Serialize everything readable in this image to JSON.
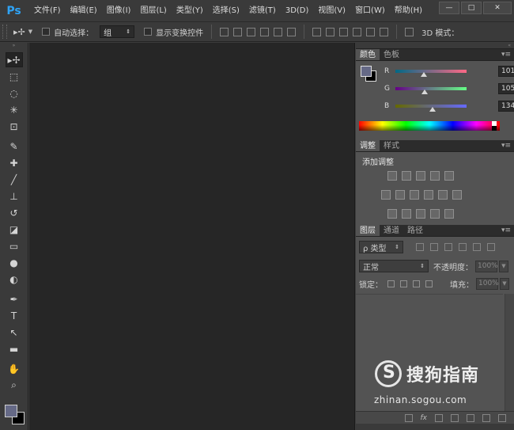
{
  "app": {
    "logo": "Ps"
  },
  "menu": [
    "文件(F)",
    "编辑(E)",
    "图像(I)",
    "图层(L)",
    "类型(Y)",
    "选择(S)",
    "滤镜(T)",
    "3D(D)",
    "视图(V)",
    "窗口(W)",
    "帮助(H)"
  ],
  "window_controls": {
    "minimize": "—",
    "maximize": "□",
    "close": "✕"
  },
  "options_bar": {
    "auto_select_label": "自动选择：",
    "auto_select_value": "组",
    "show_transform_label": "显示变换控件",
    "mode_3d_label": "3D 模式："
  },
  "tools": [
    {
      "name": "move-tool",
      "glyph": "▸✢"
    },
    {
      "name": "marquee-tool",
      "glyph": "⬚"
    },
    {
      "name": "lasso-tool",
      "glyph": "◌"
    },
    {
      "name": "magic-wand-tool",
      "glyph": "✳"
    },
    {
      "name": "crop-tool",
      "glyph": "⊡"
    },
    {
      "name": "eyedropper-tool",
      "glyph": "✎"
    },
    {
      "name": "healing-tool",
      "glyph": "✚"
    },
    {
      "name": "brush-tool",
      "glyph": "╱"
    },
    {
      "name": "stamp-tool",
      "glyph": "⊥"
    },
    {
      "name": "history-brush-tool",
      "glyph": "↺"
    },
    {
      "name": "eraser-tool",
      "glyph": "◪"
    },
    {
      "name": "gradient-tool",
      "glyph": "▭"
    },
    {
      "name": "blur-tool",
      "glyph": "●"
    },
    {
      "name": "dodge-tool",
      "glyph": "◐"
    },
    {
      "name": "pen-tool",
      "glyph": "✒"
    },
    {
      "name": "type-tool",
      "glyph": "T"
    },
    {
      "name": "path-select-tool",
      "glyph": "↖"
    },
    {
      "name": "shape-tool",
      "glyph": "▬"
    },
    {
      "name": "hand-tool",
      "glyph": "✋"
    },
    {
      "name": "zoom-tool",
      "glyph": "⌕"
    }
  ],
  "colors": {
    "foreground": "#656986",
    "background": "#000000",
    "canvas": "#262626"
  },
  "color_panel": {
    "tabs": [
      "颜色",
      "色板"
    ],
    "r_label": "R",
    "g_label": "G",
    "b_label": "B",
    "r_value": "101",
    "g_value": "105",
    "b_value": "134",
    "r": 101,
    "g": 105,
    "b": 134
  },
  "adjust_panel": {
    "tabs": [
      "调整",
      "样式"
    ],
    "title": "添加调整"
  },
  "layers_panel": {
    "tabs": [
      "图层",
      "通道",
      "路径"
    ],
    "filter_label": "ρ 类型",
    "blend_mode": "正常",
    "opacity_label": "不透明度：",
    "opacity_value": "100%",
    "lock_label": "锁定：",
    "fill_label": "填充：",
    "fill_value": "100%",
    "fx_label": "fx"
  },
  "watermark": {
    "title": "搜狗指南",
    "url": "zhinan.sogou.com"
  }
}
